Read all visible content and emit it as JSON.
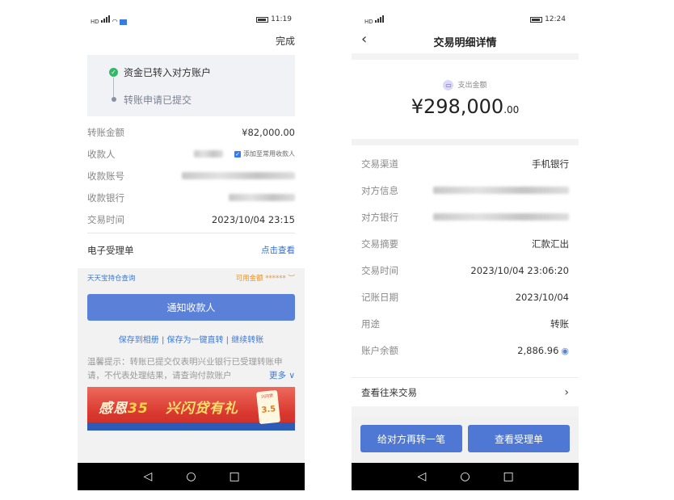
{
  "phone1": {
    "status_time": "11:19",
    "done_label": "完成",
    "steps": [
      "资金已转入对方账户",
      "转账申请已提交"
    ],
    "rows": [
      {
        "label": "转账金额",
        "value": "¥82,000.00"
      },
      {
        "label": "收款人",
        "value": "",
        "checkbox": "添加至常用收款人"
      },
      {
        "label": "收款账号",
        "value": ""
      },
      {
        "label": "收款银行",
        "value": ""
      },
      {
        "label": "交易时间",
        "value": "2023/10/04 23:15"
      }
    ],
    "receipt": {
      "label": "电子受理单",
      "link": "点击查看"
    },
    "fund_query": "天天宝持仓查询",
    "available": "可用金额 ****** ",
    "notify_button": "通知收款人",
    "links": "保存到相册 | 保存为一键直转 | 继续转账",
    "tip": "温馨提示：转账已提交仅表明兴业银行已受理转账申请，不代表处理结果，请查询付款账户",
    "more": "更多",
    "banner": {
      "text1": "感恩",
      "num": "35",
      "text2": "兴闪贷有礼",
      "card_label": "兴闪贷",
      "card_num": "3.5"
    }
  },
  "phone2": {
    "status_time": "12:24",
    "title": "交易明细详情",
    "amount_label": "支出金额",
    "amount_main": "¥298,000",
    "amount_decimal": ".00",
    "rows": [
      {
        "label": "交易渠道",
        "value": "手机银行"
      },
      {
        "label": "对方信息",
        "value": ""
      },
      {
        "label": "对方银行",
        "value": ""
      },
      {
        "label": "交易摘要",
        "value": "汇款汇出"
      },
      {
        "label": "交易时间",
        "value": "2023/10/04 23:06:20"
      },
      {
        "label": "记账日期",
        "value": "2023/10/04"
      },
      {
        "label": "用途",
        "value": "转账"
      },
      {
        "label": "账户余额",
        "value": "2,886.96"
      }
    ],
    "history": "查看往来交易",
    "btn_left": "给对方再转一笔",
    "btn_right": "查看受理单"
  },
  "icons": [
    "back-icon",
    "check-icon",
    "eye-icon",
    "chevron-right-icon",
    "nav-back-icon",
    "nav-home-icon",
    "nav-recent-icon"
  ]
}
